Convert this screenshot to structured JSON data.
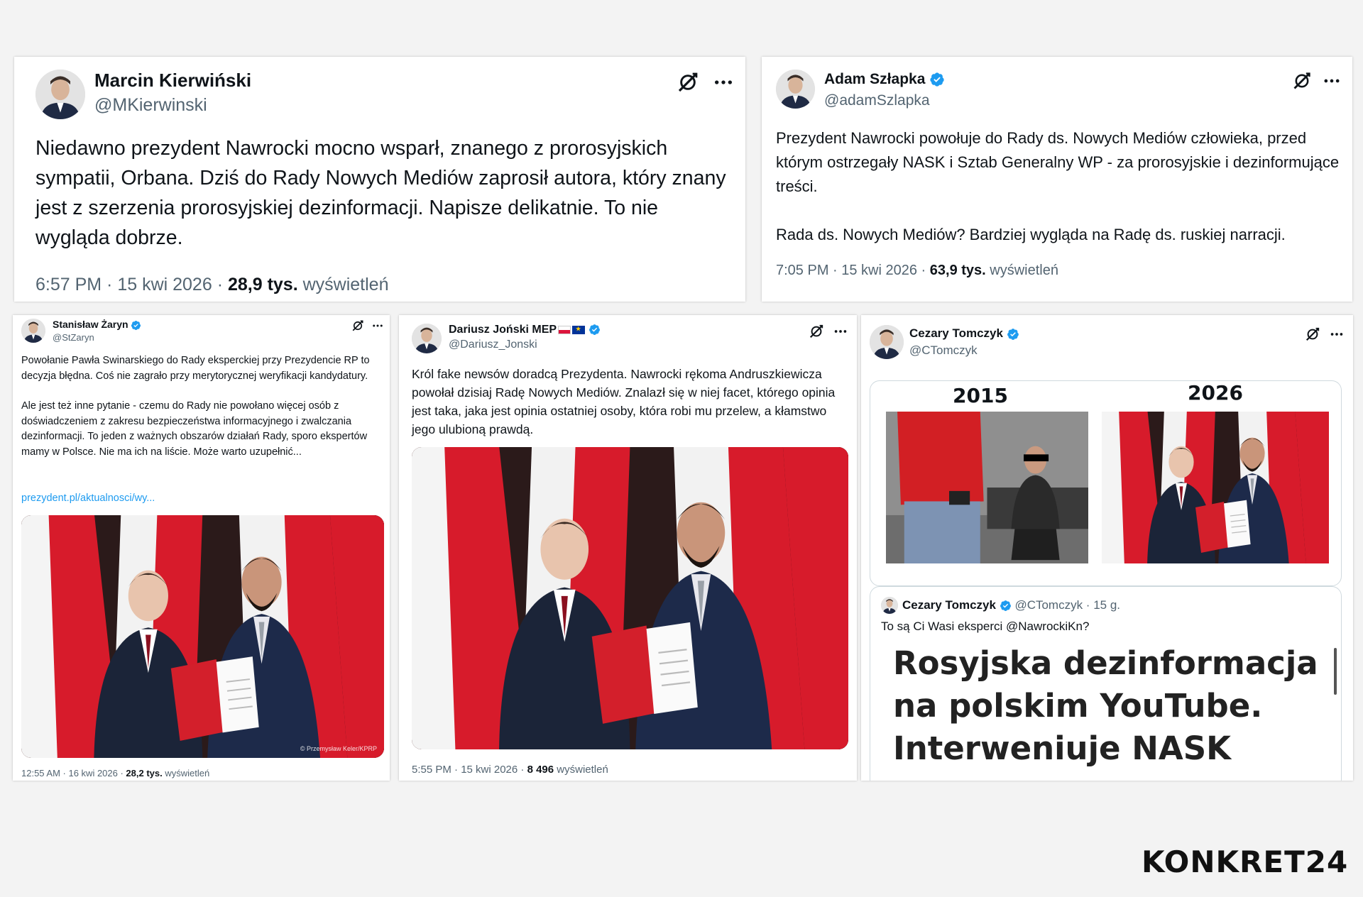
{
  "tweets": [
    {
      "name": "Marcin Kierwiński",
      "handle": "@MKierwinski",
      "text": "Niedawno prezydent Nawrocki mocno wsparł, znanego z prorosyjskich sympatii, Orbana. Dziś do Rady Nowych Mediów zaprosił autora, który znany jest z szerzenia prorosyjskiej dezinformacji. Napisze delikatnie. To nie wygląda dobrze.",
      "meta_time": "6:57 PM · 15 kwi 2026 · ",
      "meta_views": "28,9 tys.",
      "meta_suffix": " wyświetleń"
    },
    {
      "name": "Adam Szłapka",
      "handle": "@adamSzlapka",
      "text_p1": "Prezydent Nawrocki powołuje do Rady ds. Nowych Mediów człowieka, przed którym ostrzegały NASK i Sztab Generalny WP - za prorosyjskie i dezinformujące treści.",
      "text_p2": "Rada ds. Nowych Mediów? Bardziej wygląda na Radę ds. ruskiej narracji.",
      "meta_time": "7:05 PM · 15 kwi 2026 · ",
      "meta_views": "63,9 tys.",
      "meta_suffix": " wyświetleń"
    },
    {
      "name": "Stanisław Żaryn",
      "handle": "@StZaryn",
      "text_p1": "Powołanie Pawła Swinarskiego do Rady eksperckiej przy Prezydencie RP to decyzja błędna. Coś nie zagrało przy merytorycznej weryfikacji kandydatury.",
      "text_p2": "Ale jest też inne pytanie - czemu do Rady nie powołano więcej osób z doświadczeniem z zakresu bezpieczeństwa informacyjnego i zwalczania dezinformacji. To jeden z ważnych obszarów działań Rady, sporo ekspertów mamy w Polsce. Nie ma ich na liście. Może warto uzupełnić...",
      "link": "prezydent.pl/aktualnosci/wy...",
      "photo_credit": "© Przemysław Keler/KPRP",
      "meta_time": "12:55 AM · 16 kwi 2026 · ",
      "meta_views": "28,2 tys.",
      "meta_suffix": " wyświetleń"
    },
    {
      "name": "Dariusz Joński MEP",
      "handle": "@Dariusz_Jonski",
      "text": "Król fake newsów doradcą Prezydenta. Nawrocki rękoma Andruszkiewicza powołał dzisiaj Radę Nowych Mediów. Znalazł się w niej facet, którego opinia jest taka, jaka jest opinia ostatniej osoby, która robi mu przelew, a kłamstwo jego ulubioną prawdą.",
      "meta_time": "5:55 PM · 15 kwi 2026 · ",
      "meta_views": "8 496",
      "meta_suffix": " wyświetleń"
    },
    {
      "name": "Cezary Tomczyk",
      "handle": "@CTomczyk",
      "year_left": "2015",
      "year_right": "2026",
      "quote_name": "Cezary Tomczyk",
      "quote_handle": "@CTomczyk · 15 g.",
      "quote_text": "To są Ci Wasi eksperci @NawrockiKn?",
      "quote_headline": "Rosyjska dezinformacja na polskim YouTube. Interweniuje NASK"
    }
  ],
  "brand": {
    "logo": "KONKRET24"
  },
  "colors": {
    "verified": "#1d9bf0",
    "flag_red": "#dc143c",
    "link": "#1d9bf0"
  }
}
